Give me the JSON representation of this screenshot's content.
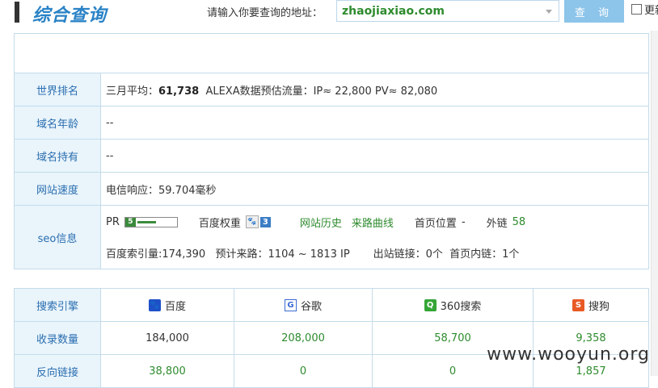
{
  "header": {
    "brand": "综合查询",
    "prompt": "请输入你要查询的地址：",
    "query_value": "zhaojiaxiao.com",
    "search_button": "查 询",
    "checkbox_label": "更新"
  },
  "info": {
    "rank_label": "世界排名",
    "rank_prefix": "三月平均：",
    "rank_value": "61,738",
    "rank_suffix": "ALEXA数据预估流量：IP≈ 22,800 PV≈ 82,080",
    "age_label": "域名年龄",
    "age_value": "--",
    "holder_label": "域名持有",
    "holder_value": "--",
    "speed_label": "网站速度",
    "speed_value": "电信响应：59.704毫秒",
    "seo_label": "seo信息",
    "pr_label": "PR",
    "pr_value": "5",
    "pr_level": 0.5,
    "baidu_weight_label": "百度权重",
    "baidu_weight_value": "3",
    "history_link": "网站历史",
    "traffic_link": "来路曲线",
    "home_pos_label": "首页位置",
    "home_pos_value": "-",
    "outlink_label": "外链",
    "outlink_value": "58",
    "seo_line2": "百度索引量:174,390   预计来路：1104 ~ 1813 IP       出站链接：0个  首页内链：1个"
  },
  "engines": {
    "header_label": "搜索引擎",
    "list": [
      {
        "name": "百度",
        "icon": "baidu-paw-icon",
        "glyph": "🐾",
        "color": "#1e50c8"
      },
      {
        "name": "谷歌",
        "icon": "google-g-icon",
        "glyph": "G",
        "color": "#3a6ad4"
      },
      {
        "name": "360搜索",
        "icon": "search-360-icon",
        "glyph": "Q",
        "color": "#35a636"
      },
      {
        "name": "搜狗",
        "icon": "sogou-s-icon",
        "glyph": "S",
        "color": "#e85a25"
      }
    ],
    "rows": [
      {
        "label": "收录数量",
        "values": [
          "184,000",
          "208,000",
          "58,700",
          "9,358"
        ]
      },
      {
        "label": "反向链接",
        "values": [
          "38,800",
          "0",
          "0",
          "1,857"
        ]
      }
    ]
  },
  "watermark": "www.wooyun.org"
}
